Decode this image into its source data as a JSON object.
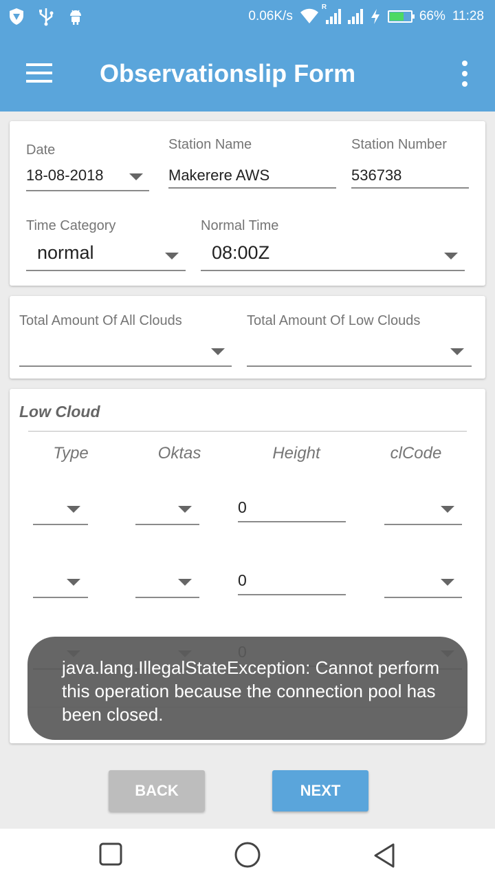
{
  "status_bar": {
    "network_speed": "0.06K/s",
    "roaming_indicator": "R",
    "battery_percent": "66%",
    "battery_level": 0.66,
    "time": "11:28",
    "icons": [
      "shield-icon",
      "usb-icon",
      "android-icon",
      "wifi-icon",
      "signal-icon",
      "charging-icon",
      "battery-icon"
    ]
  },
  "app_bar": {
    "title": "Observationslip Form",
    "menu_icon": "hamburger-menu-icon",
    "overflow_icon": "more-vert-icon"
  },
  "form": {
    "date": {
      "label": "Date",
      "value": "18-08-2018"
    },
    "station_name": {
      "label": "Station Name",
      "value": "Makerere AWS"
    },
    "station_number": {
      "label": "Station Number",
      "value": "536738"
    },
    "time_category": {
      "label": "Time Category",
      "value": "normal"
    },
    "normal_time": {
      "label": "Normal Time",
      "value": "08:00Z"
    }
  },
  "clouds": {
    "total_all": {
      "label": "Total Amount Of All Clouds",
      "value": ""
    },
    "total_low": {
      "label": "Total Amount Of Low Clouds",
      "value": ""
    }
  },
  "low_cloud": {
    "title": "Low Cloud",
    "columns": [
      "Type",
      "Oktas",
      "Height",
      "clCode"
    ],
    "rows": [
      {
        "type": "",
        "oktas": "",
        "height": "0",
        "clcode": ""
      },
      {
        "type": "",
        "oktas": "",
        "height": "0",
        "clcode": ""
      },
      {
        "type": "",
        "oktas": "",
        "height": "0",
        "clcode": ""
      }
    ]
  },
  "toast": {
    "message": "java.lang.IllegalStateException: Cannot perform this operation because the connection pool has been closed."
  },
  "buttons": {
    "back": "BACK",
    "next": "NEXT"
  },
  "colors": {
    "primary": "#5aa5db",
    "disabled_button": "#bdbdbd",
    "toast_bg": "#5a5a5a",
    "background": "#ececec"
  },
  "nav_bar": {
    "icons": [
      "recents-square-icon",
      "home-circle-icon",
      "back-triangle-icon"
    ]
  }
}
